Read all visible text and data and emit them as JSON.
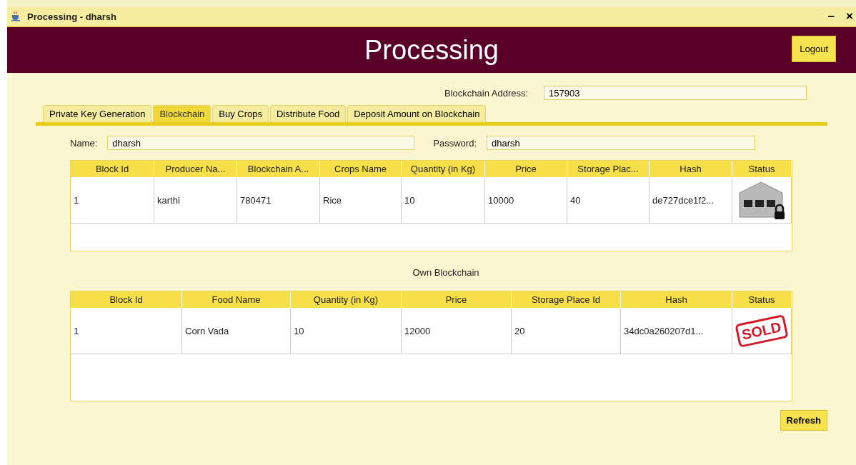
{
  "window": {
    "title": "Processing - dharsh",
    "controls": [
      "–",
      "×"
    ]
  },
  "header": {
    "title": "Processing",
    "logout": "Logout"
  },
  "address": {
    "label": "Blockchain Address:",
    "value": "157903"
  },
  "tabs": [
    {
      "label": "Private Key Generation",
      "selected": false
    },
    {
      "label": "Blockchain",
      "selected": true
    },
    {
      "label": "Buy Crops",
      "selected": false
    },
    {
      "label": "Distribute Food",
      "selected": false
    },
    {
      "label": "Deposit Amount on Blockchain",
      "selected": false
    }
  ],
  "name": {
    "label": "Name:",
    "value": "dharsh"
  },
  "password": {
    "label": "Password:",
    "value": "dharsh"
  },
  "crops_table": {
    "columns": [
      "Block Id",
      "Producer Na...",
      "Blockchain A...",
      "Crops Name",
      "Quantity (in Kg)",
      "Price",
      "Storage Plac...",
      "Hash",
      "Status"
    ],
    "rows": [
      {
        "cells": [
          "1",
          "karthi",
          "780471",
          "Rice",
          "10",
          "10000",
          "40",
          "de727dce1f2..."
        ],
        "status": {
          "kind": "locked"
        }
      }
    ]
  },
  "own_title": "Own Blockchain",
  "own_table": {
    "columns": [
      "Block Id",
      "Food Name",
      "Quantity (in Kg)",
      "Price",
      "Storage Place Id",
      "Hash",
      "Status"
    ],
    "rows": [
      {
        "cells": [
          "1",
          "Corn Vada",
          "10",
          "12000",
          "20",
          "34dc0a260207d1..."
        ],
        "status": {
          "kind": "sold",
          "text": "SOLD"
        }
      }
    ]
  },
  "refresh": "Refresh"
}
